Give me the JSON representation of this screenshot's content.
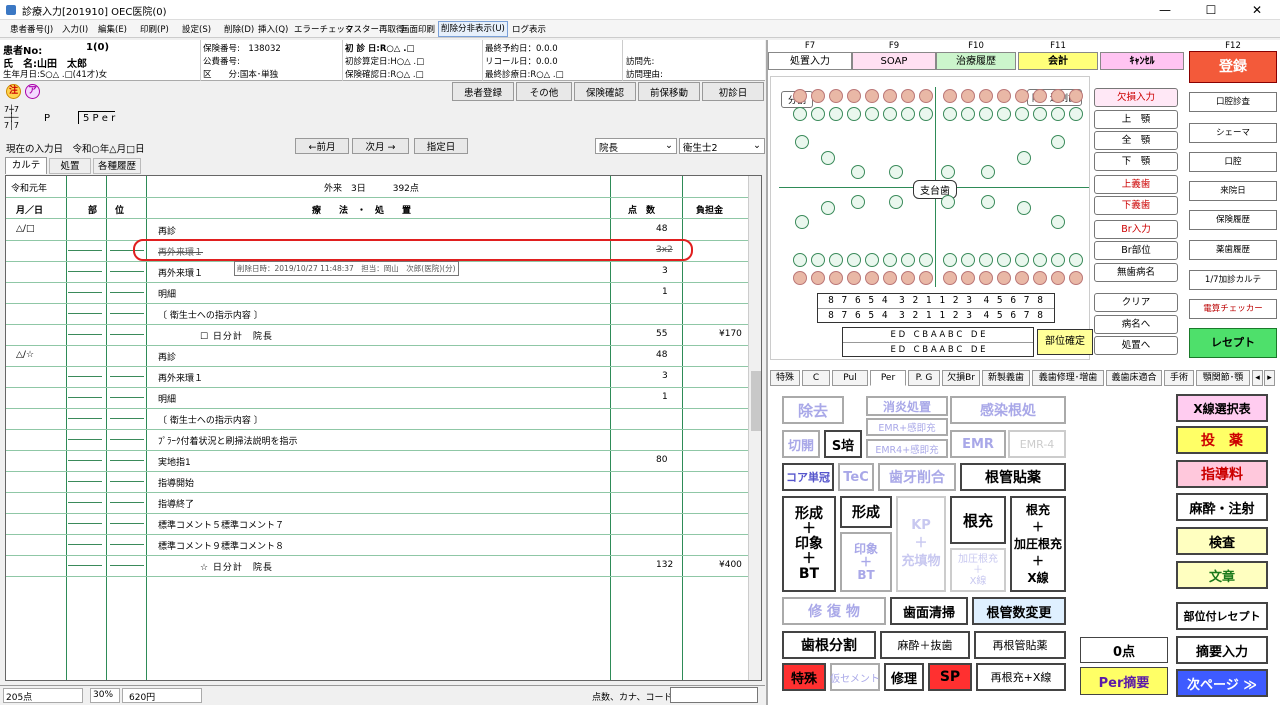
{
  "window": {
    "title": "診療入力[201910] OEC医院(0)",
    "min": "—",
    "max": "☐",
    "close": "✕"
  },
  "menu": [
    "患者番号(J)",
    "入力(I)",
    "編集(E)",
    "印刷(P)",
    "設定(S)",
    "削除(D)",
    "挿入(Q)",
    "エラーチェック",
    "マスター再取得",
    "画面印刷",
    "削除分非表示(U)",
    "ログ表示"
  ],
  "patient": {
    "no_label": "患者No:",
    "no": "1(0)",
    "name_label": "氏　名:山田　太郎",
    "birth": "生年月日:S○△ .□(41才)女",
    "insurer": "保険番号:　138032",
    "public": "公費番号:",
    "kubun": "区　　分:国本･単独",
    "first": "初 診 日:R○△ .□",
    "first_calc": "初診算定日:H○△ .□",
    "confirm": "保険確認日:R○△ .□",
    "last_appt": "最終予約日：0.0.0",
    "recall": "リコール日：0.0.0",
    "last_visit": "最終診療日:R○△ .□",
    "visit_dest": "訪問先:",
    "visit_reason": "訪問理由:",
    "badge1": "注",
    "badge2": "ア"
  },
  "actions": [
    "患者登録",
    "その他",
    "保険確認",
    "前保移動",
    "初診日"
  ],
  "perio": {
    "frac_top": "7",
    "frac_mid": "7",
    "frac_bot": "7",
    "suffix": "P",
    "per": "5 P e r"
  },
  "date_line": "現在の入力日　令和○年△月□日",
  "nav": {
    "prev": "←前月",
    "next": "次月 →",
    "spec": "指定日"
  },
  "dropdowns": {
    "doctor": "院長",
    "hygienist": "衛生士2"
  },
  "tabs": [
    "カルテ",
    "処置",
    "各種履歴"
  ],
  "grid": {
    "era": "令和元年",
    "visit": "外来　3日　　　392点",
    "headers": {
      "date": "月／日",
      "site": "部　　位",
      "tx": "療　　法　・　処　　置",
      "pts": "点　数",
      "burden": "負担金"
    },
    "rows": [
      {
        "date": "△/□",
        "tx": "再診",
        "pts": "48",
        "burden": ""
      },
      {
        "date": "",
        "tx": "再外来環１",
        "pts": "3x2",
        "burden": "",
        "deleted": true
      },
      {
        "date": "",
        "tx": "再外来環１",
        "pts": "3",
        "burden": ""
      },
      {
        "date": "",
        "tx": "明細",
        "pts": "1",
        "burden": ""
      },
      {
        "date": "",
        "tx": "〔 衛生士への指示内容 〕",
        "pts": "",
        "burden": ""
      },
      {
        "date": "",
        "tx": "☐ 日分計　院長",
        "pts": "55",
        "burden": "¥170",
        "total": true
      },
      {
        "date": "△/☆",
        "tx": "再診",
        "pts": "48",
        "burden": ""
      },
      {
        "date": "",
        "tx": "再外来環１",
        "pts": "3",
        "burden": ""
      },
      {
        "date": "",
        "tx": "明細",
        "pts": "1",
        "burden": ""
      },
      {
        "date": "",
        "tx": "〔 衛生士への指示内容 〕",
        "pts": "",
        "burden": ""
      },
      {
        "date": "",
        "tx": "ﾌﾟﾗｰｸ付着状況と刷掃法説明を指示",
        "pts": "",
        "burden": ""
      },
      {
        "date": "",
        "tx": "実地指1",
        "pts": "80",
        "burden": ""
      },
      {
        "date": "",
        "tx": "指導開始",
        "pts": "",
        "burden": ""
      },
      {
        "date": "",
        "tx": "指導終了",
        "pts": "",
        "burden": ""
      },
      {
        "date": "",
        "tx": "標準コメント５標準コメント７",
        "pts": "",
        "burden": ""
      },
      {
        "date": "",
        "tx": "標準コメント９標準コメント８",
        "pts": "",
        "burden": ""
      },
      {
        "date": "",
        "tx": "☆ 日分計　院長",
        "pts": "132",
        "burden": "¥400",
        "total": true
      }
    ],
    "tooltip": "削除日時：2019/10/27 11:48:37　担当：岡山　次郎(医院)(分)"
  },
  "status": {
    "pts": "205点",
    "pct": "30%",
    "yen": "620円",
    "search_label": "点数、カナ、コード"
  },
  "fkeys": [
    {
      "key": "F7",
      "label": "処置入力",
      "color": "#fff"
    },
    {
      "key": "F9",
      "label": "SOAP",
      "color": "#ffd0ee"
    },
    {
      "key": "F10",
      "label": "治療履歴",
      "color": "#c8f5c8"
    },
    {
      "key": "F11",
      "label": "会計",
      "color": "#ffff80"
    },
    {
      "key": "",
      "label": "ｷｬﾝｾﾙ",
      "color": "#ffc0f0"
    },
    {
      "key": "F12",
      "label": "登録",
      "color": "#f35a3a"
    }
  ],
  "dental": {
    "split": "分割",
    "kind": "除・過剰歯",
    "support": "支台歯",
    "confirm": "部位確定",
    "upper": "8 7 6 5 4　3 2 1 1 2 3　4 5 6 7 8",
    "lower": "8 7 6 5 4　3 2 1 1 2 3　4 5 6 7 8",
    "deciduous_upper": "E D　C B A A B C　D E",
    "deciduous_lower": "E D　C B A A B C　D E"
  },
  "side_buttons": [
    "欠損入力",
    "上　顎",
    "全　顎",
    "下　顎",
    "上義歯",
    "下義歯",
    "Br入力",
    "Br部位",
    "無歯病名",
    "クリア",
    "病名へ",
    "処置へ"
  ],
  "right_col": [
    "口腔診査",
    "シェーマ",
    "口腔",
    "来院日",
    "保険履歴",
    "薬歯履歴",
    "1/7加診カルテ",
    "電算チェッカー",
    "レセプト"
  ],
  "tabs2": [
    "特殊",
    "C",
    "Pul",
    "Per",
    "P. G",
    "欠損Br",
    "新製義歯",
    "義歯修理･増歯",
    "義歯床適合",
    "手術",
    "顎関節･顎"
  ],
  "pad": {
    "jokyo": "除去",
    "shoen": "消炎処置",
    "kansen": "感染根処",
    "kaihei": "切開",
    "spol": "S培",
    "emr_kan": "EMR+感即充",
    "emr4": "EMR4+感即充",
    "emr": "EMR",
    "emr4b": "EMR-4",
    "core": "コア単冠",
    "tec": "TeC",
    "shiga": "歯牙削合",
    "kontei": "根管貼薬",
    "keisei_im": "形成\n＋\n印象\n＋\nBT",
    "keisei": "形成",
    "inshou_bt": "印象\n＋\nBT",
    "kp": "KP\n＋\n充填物",
    "konju": "根充",
    "konju_k": "根充\n＋\n加圧根充\n＋\nX線",
    "kaatsu": "加圧根充\n＋\nX線",
    "shufuku": "修 復 物",
    "shimen": "歯面清掃",
    "konkan_chg": "根管数変更",
    "bunkatsu": "歯根分割",
    "masui_batsu": "麻酔＋抜歯",
    "sai_kontei": "再根管貼薬",
    "tokushu": "特殊",
    "kari_cem": "仮セメント",
    "shuri": "修理",
    "sp": "SP",
    "sai_konju": "再根充+X線",
    "zero": "0点",
    "per_teki": "Per摘要"
  },
  "right_pad": [
    "X線選択表",
    "投　薬",
    "指導料",
    "麻酔・注射",
    "検査",
    "文章",
    "部位付レセプト",
    "摘要入力",
    "次ページ ≫"
  ]
}
